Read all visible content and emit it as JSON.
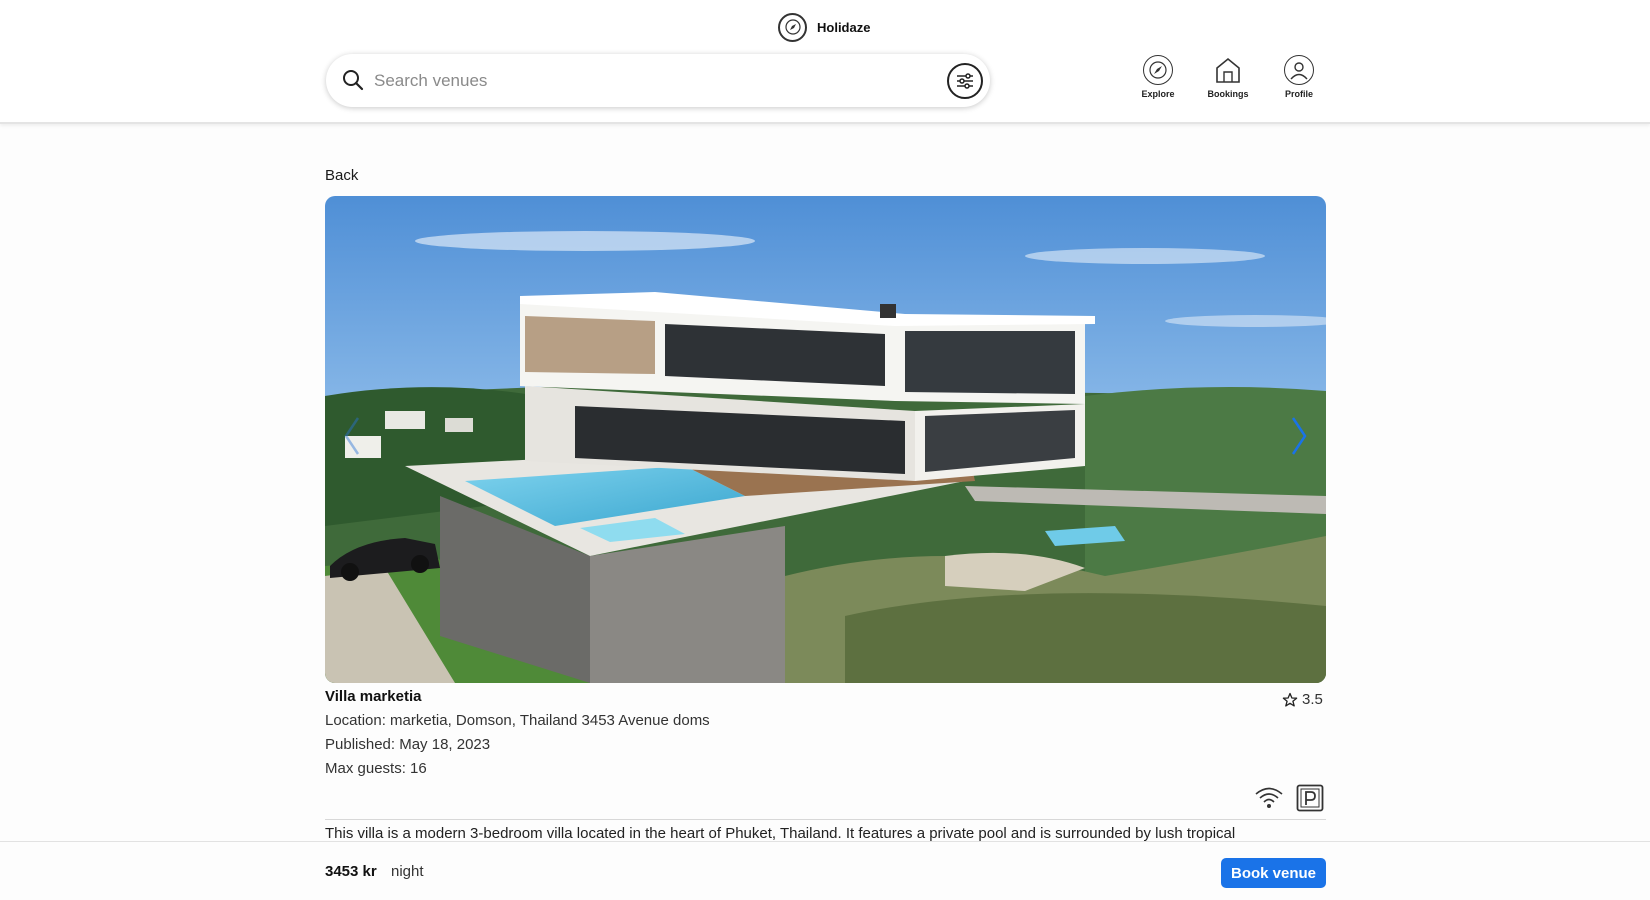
{
  "header": {
    "brand_name": "Holidaze",
    "search": {
      "placeholder": "Search venues",
      "value": ""
    },
    "nav": [
      {
        "label": "Explore",
        "icon": "compass-icon"
      },
      {
        "label": "Bookings",
        "icon": "house-icon"
      },
      {
        "label": "Profile",
        "icon": "user-icon"
      }
    ]
  },
  "main": {
    "back_label": "Back",
    "venue": {
      "name": "Villa marketia",
      "rating": "3.5",
      "location": "Location: marketia, Domson, Thailand 3453 Avenue doms",
      "published": "Published: May 18, 2023",
      "max_guests": "Max guests: 16",
      "amenities": [
        "wifi-icon",
        "parking-icon"
      ],
      "description": "This villa is a modern 3-bedroom villa located in the heart of Phuket, Thailand. It features a private pool and is surrounded by lush tropical"
    }
  },
  "footer": {
    "price": "3453 kr",
    "per": "night",
    "book_label": "Book venue"
  },
  "colors": {
    "accent": "#1a73e8",
    "sky": "#6aa6e0"
  }
}
